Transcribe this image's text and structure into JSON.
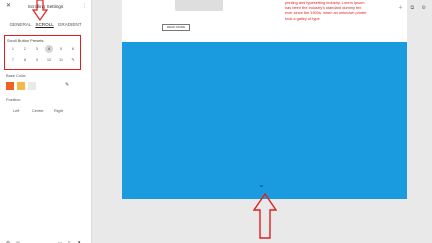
{
  "panel": {
    "title": "Scrolling Settings",
    "tabs": [
      "GENERAL",
      "SCROLL",
      "GRADIENT"
    ],
    "presets_label": "Scroll Button Presets:",
    "presets": [
      "1",
      "2",
      "3",
      "4",
      "5",
      "6",
      "7",
      "8",
      "9",
      "10",
      "11"
    ],
    "selected_preset": "4",
    "base_color_label": "Base Color:",
    "colors": [
      "#f06021",
      "#f5b84a",
      "#e9e9e9"
    ],
    "position_label": "Position:",
    "positions": [
      "Left",
      "Center",
      "Right"
    ]
  },
  "canvas": {
    "red_text": [
      "printing and typesetting industry. Lorem Ipsum",
      "has been the industry's standard dummy tex",
      "ever since the 1500s, when an unknown printer",
      "took a galley of type"
    ],
    "read_more": "READ MORE",
    "background_color": "#1a9be0"
  }
}
